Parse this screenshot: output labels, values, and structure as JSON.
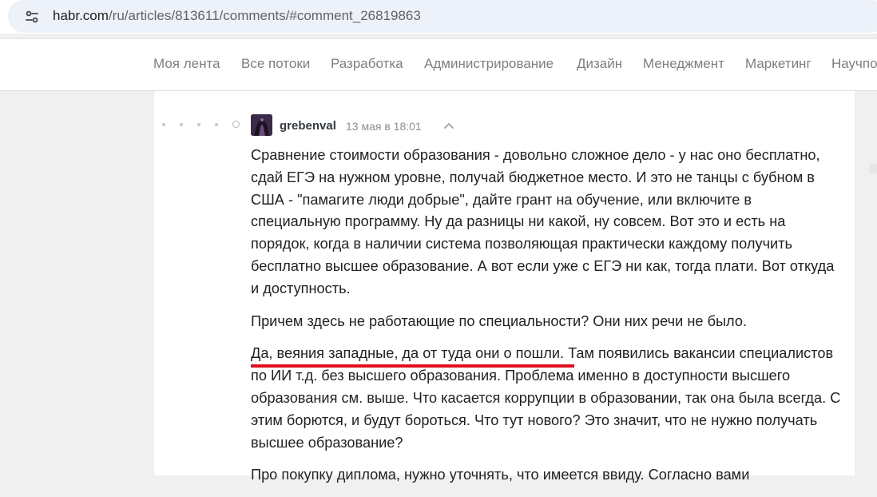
{
  "browser": {
    "url_host": "habr.com",
    "url_path": "/ru/articles/813611/comments/#comment_26819863",
    "site_info_icon": "tune-icon"
  },
  "nav": {
    "items": [
      "Моя лента",
      "Все потоки",
      "Разработка",
      "Администрирование",
      "Дизайн",
      "Менеджмент",
      "Маркетинг",
      "Научпоп"
    ]
  },
  "comment": {
    "username": "grebenval",
    "time": "13 мая в 18:01",
    "paragraphs": [
      "Сравнение стоимости образования - довольно сложное дело - у нас оно бесплатно, сдай ЕГЭ на нужном уровне, получай бюджетное место. И это не танцы с бубном в США - \"памагите люди добрые\", дайте грант на обучение, или включите в специальную программу. Ну да разницы ни какой, ну совсем. Вот это и есть на порядок, когда в наличии система позволяющая практически каждому получить бесплатно высшее образование. А вот если уже с ЕГЭ ни как, тогда плати. Вот откуда и доступность.",
      "Причем здесь не работающие по специальности? Они них речи не было."
    ],
    "para3_highlight": "Да, веяния западные, да от туда они о пошли",
    "para3_rest": ". Там появились вакансии специалистов по ИИ т.д. без высшего образования. Проблема именно в доступности высшего образования см. выше. Что касается коррупции в образовании, так она была всегда. С этим борются, и будут бороться. Что тут нового? Это значит, что не нужно получать высшее образование?",
    "para4_partial": "Про покупку диплома, нужно уточнять, что имеется ввиду. Согласно вами"
  },
  "colors": {
    "highlight_underline": "#e00f1f",
    "nav_text": "#7b7f83",
    "page_bg": "#f0f0f0"
  }
}
